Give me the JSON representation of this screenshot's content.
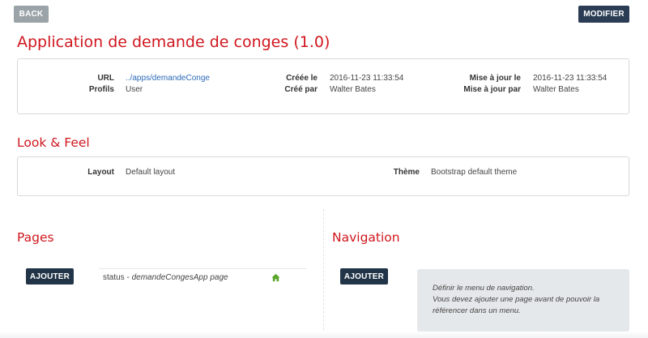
{
  "header": {
    "back_label": "BACK",
    "modify_label": "MODIFIER"
  },
  "app": {
    "title": "Application de demande de conges (1.0)"
  },
  "info": {
    "url_label": "URL",
    "url_value": "../apps/demandeConge",
    "profiles_label": "Profils",
    "profiles_value": "User",
    "created_label": "Créée le",
    "created_value": "2016-11-23 11:33:54",
    "created_by_label": "Créé par",
    "created_by_value": "Walter Bates",
    "updated_label": "Mise à jour le",
    "updated_value": "2016-11-23 11:33:54",
    "updated_by_label": "Mise à jour par",
    "updated_by_value": "Walter Bates"
  },
  "look": {
    "title": "Look & Feel",
    "layout_label": "Layout",
    "layout_value": "Default layout",
    "theme_label": "Thème",
    "theme_value": "Bootstrap default theme"
  },
  "pages": {
    "title": "Pages",
    "add_label": "AJOUTER",
    "rows": [
      {
        "name": "status",
        "separator": " - ",
        "page": "demandeCongesApp page",
        "home_icon": "home-icon",
        "home_color": "#5aa52a"
      }
    ]
  },
  "navigation": {
    "title": "Navigation",
    "add_label": "AJOUTER",
    "note_lines": [
      "Définir le menu de navigation.",
      "Vous devez ajouter une page avant de pouvoir la",
      "référencer dans un menu."
    ]
  },
  "colors": {
    "accent_red": "#d0161d",
    "dark_button": "#223548",
    "back_button": "#9aa3a8",
    "link_blue": "#2a6ab8"
  }
}
